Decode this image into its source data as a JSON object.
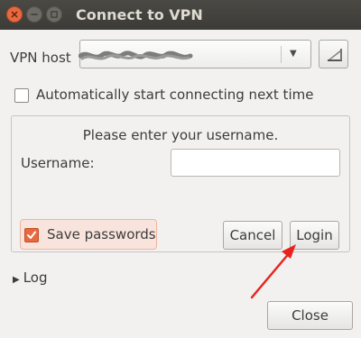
{
  "window": {
    "title": "Connect to VPN"
  },
  "host_row": {
    "label": "VPN host",
    "value": ""
  },
  "auto_connect": {
    "label": "Automatically start connecting next time",
    "checked": false
  },
  "credentials": {
    "prompt": "Please enter your username.",
    "username_label": "Username:",
    "username_value": ""
  },
  "save_passwords": {
    "label": "Save passwords",
    "checked": true
  },
  "buttons": {
    "cancel": "Cancel",
    "login": "Login",
    "close": "Close"
  },
  "log": {
    "label": "Log",
    "expanded": false
  },
  "icons": {
    "close": "window-close-icon",
    "minimize": "window-minimize-icon",
    "maximize": "window-maximize-icon",
    "dropdown": "chevron-down-icon",
    "host_action": "network-certificate-icon",
    "log_toggle": "disclosure-triangle-icon"
  },
  "colors": {
    "titlebar": "#3c3b37",
    "accent": "#e9693f",
    "background": "#f2f1f0",
    "annotation_arrow": "#e8231f"
  }
}
